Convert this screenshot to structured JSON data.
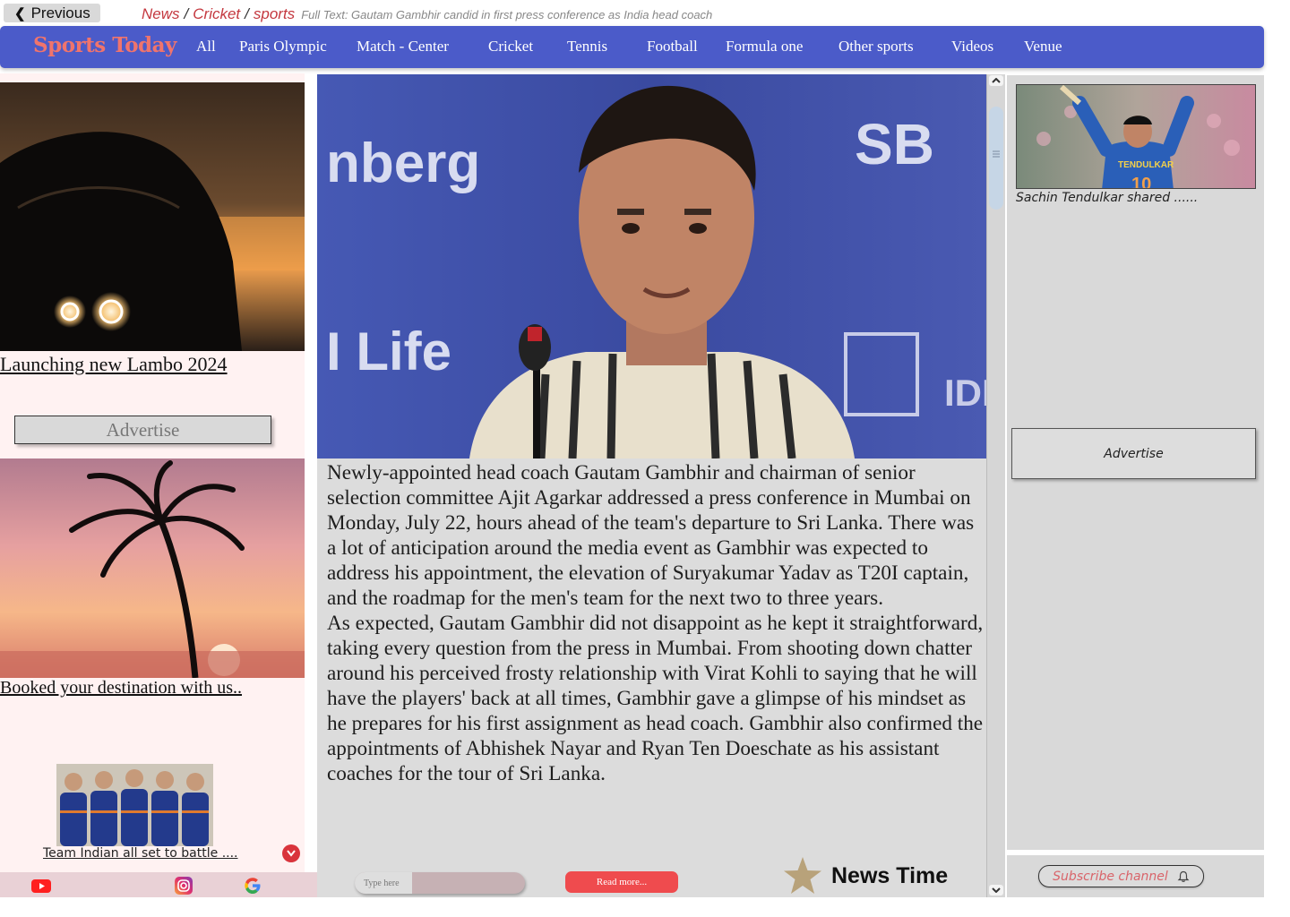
{
  "top": {
    "previous_label": "Previous",
    "breadcrumbs": [
      "News",
      "Cricket",
      "sports"
    ],
    "separator": "/",
    "full_text": "Full Text: Gautam Gambhir candid in first press conference as India head coach"
  },
  "nav": {
    "logo": "Sports Today",
    "items": [
      "All",
      "Paris Olympic",
      "Match - Center",
      "Cricket",
      "Tennis",
      "Football",
      "Formula one",
      "Other sports",
      "Videos",
      "Venue"
    ],
    "bar_color": "#4b5bc9",
    "logo_color": "#f0746c"
  },
  "left": {
    "card1_title": "Launching new Lambo 2024",
    "advertise": "Advertise",
    "card2_title": "Booked your destination with us..",
    "card3_title": "Team Indian all set to battle ....",
    "social": [
      "youtube-icon",
      "instagram-icon",
      "google-icon"
    ]
  },
  "article": {
    "paragraphs": [
      "Newly-appointed head coach Gautam Gambhir and chairman of senior selection committee Ajit Agarkar addressed a press conference in Mumbai on Monday, July 22, hours ahead of the team's departure to Sri Lanka. There was a lot of anticipation around the media event as Gambhir was expected to address his appointment, the elevation of Suryakumar Yadav as T20I captain, and the roadmap for the men's team for the next two to three years.",
      "As expected, Gautam Gambhir did not disappoint as he kept it straightforward, taking every question from the press in Mumbai. From shooting down chatter around his perceived frosty relationship with Virat Kohli to saying that he will have the players' back at all times, Gambhir gave a glimpse of his mindset as he prepares for his first assignment as head coach. Gambhir also confirmed the appointments of Abhishek Nayar and Ryan Ten Doeschate as his assistant coaches for the tour of Sri Lanka."
    ],
    "input_placeholder": "Type here",
    "read_more": "Read more...",
    "news_time": "News Time",
    "read_more_color": "#ef4b4e"
  },
  "right": {
    "card_title": "Sachin Tendulkar shared ......",
    "advertise": "Advertise",
    "subscribe": "Subscribe channel"
  }
}
